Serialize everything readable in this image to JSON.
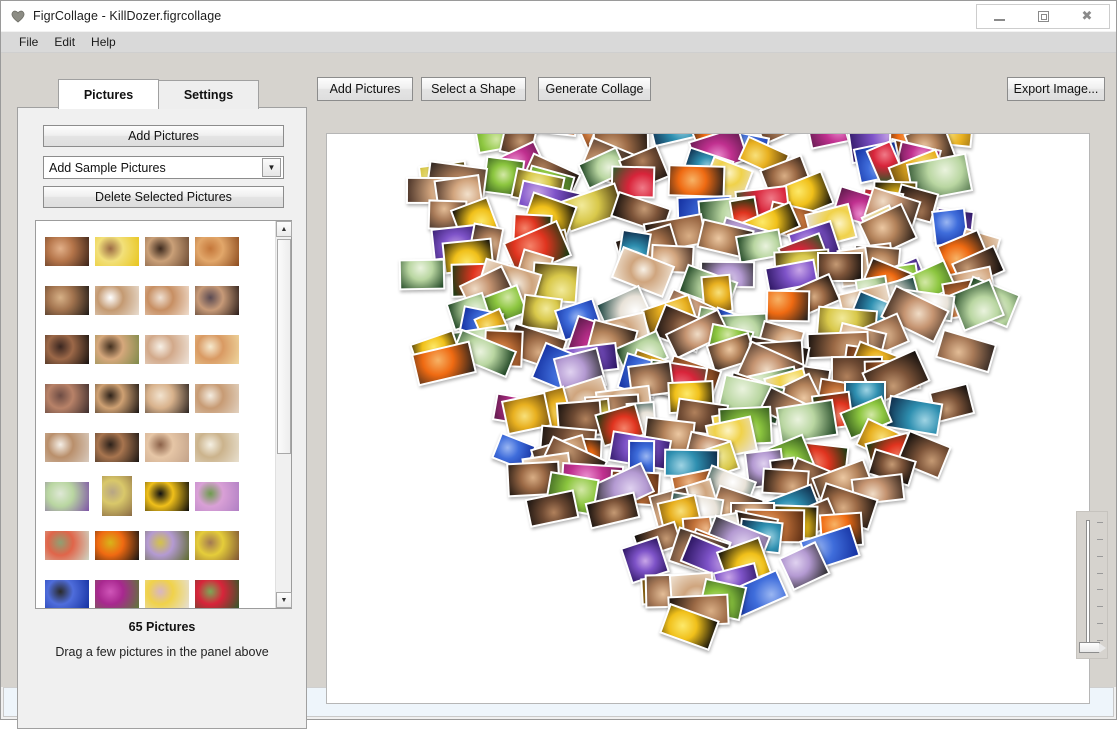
{
  "window": {
    "title": "FigrCollage - KillDozer.figrcollage",
    "app_icon": "heart-icon",
    "minimize_label": "–",
    "maximize_label": "□",
    "close_label": "✕"
  },
  "menubar": {
    "items": [
      {
        "label": "File"
      },
      {
        "label": "Edit"
      },
      {
        "label": "Help"
      }
    ]
  },
  "sidebar": {
    "tabs": [
      {
        "label": "Pictures",
        "active": true
      },
      {
        "label": "Settings",
        "active": false
      }
    ],
    "add_pictures_label": "Add Pictures",
    "sample_combo": {
      "value": "Add Sample Pictures",
      "arrow_icon": "chevron-down-icon"
    },
    "delete_label": "Delete Selected Pictures",
    "scrollbar": {
      "up_icon": "caret-up-icon",
      "down_icon": "caret-down-icon"
    },
    "count_label": "65 Pictures",
    "hint_label": "Drag a few pictures in the panel above",
    "thumbnails": [
      {
        "kind": "portrait",
        "c1": "#3b2318",
        "c2": "#b5754a",
        "c3": "#e2b089"
      },
      {
        "kind": "portrait",
        "c1": "#e8c51d",
        "c2": "#f2e07a",
        "c3": "#9c6b45"
      },
      {
        "kind": "portrait",
        "c1": "#6b4a33",
        "c2": "#caa078",
        "c3": "#3d2a1e"
      },
      {
        "kind": "portrait",
        "c1": "#8b4a1e",
        "c2": "#e2a76a",
        "c3": "#c4773a"
      },
      {
        "kind": "portrait",
        "c1": "#1f1a16",
        "c2": "#a3744f",
        "c3": "#d7b187"
      },
      {
        "kind": "portrait",
        "c1": "#e9ddd0",
        "c2": "#c49a72",
        "c3": "#ffffff"
      },
      {
        "kind": "portrait",
        "c1": "#f0ddcd",
        "c2": "#c78f63",
        "c3": "#efe0d2"
      },
      {
        "kind": "portrait",
        "c1": "#2a1c18",
        "c2": "#c79a78",
        "c3": "#5a4a52"
      },
      {
        "kind": "portrait",
        "c1": "#17110e",
        "c2": "#9c6848",
        "c3": "#3a2620"
      },
      {
        "kind": "portrait",
        "c1": "#7d8a4a",
        "c2": "#d6a87c",
        "c3": "#43301f"
      },
      {
        "kind": "portrait",
        "c1": "#efe4d9",
        "c2": "#d2a98a",
        "c3": "#f7f0e6"
      },
      {
        "kind": "portrait",
        "c1": "#efd79f",
        "c2": "#d99a63",
        "c3": "#f6e9cd"
      },
      {
        "kind": "portrait",
        "c1": "#3c2c2c",
        "c2": "#b88268",
        "c3": "#6d4c44"
      },
      {
        "kind": "portrait",
        "c1": "#1a1512",
        "c2": "#cfa173",
        "c3": "#2e2219"
      },
      {
        "kind": "portrait",
        "c1": "#2b2320",
        "c2": "#d8b28c",
        "c3": "#f2e3cf"
      },
      {
        "kind": "portrait",
        "c1": "#e2d2c0",
        "c2": "#c79b74",
        "c3": "#f4ece0"
      },
      {
        "kind": "portrait",
        "c1": "#d9cbbe",
        "c2": "#b98f6b",
        "c3": "#f5efe7"
      },
      {
        "kind": "portrait",
        "c1": "#1b1613",
        "c2": "#a8754f",
        "c3": "#2c211a"
      },
      {
        "kind": "portrait",
        "c1": "#c2a289",
        "c2": "#e6c6a6",
        "c3": "#8b6148"
      },
      {
        "kind": "portrait",
        "c1": "#e8e0cf",
        "c2": "#cbb38c",
        "c3": "#f5f0e3"
      },
      {
        "kind": "flower",
        "c1": "#7e53a8",
        "c2": "#b9d6a1",
        "c3": "#dfe8d6"
      },
      {
        "kind": "flower-tall",
        "c1": "#8a6b45",
        "c2": "#d9c86a",
        "c3": "#b7a585"
      },
      {
        "kind": "flower",
        "c1": "#0a0a0a",
        "c2": "#f0c01a",
        "c3": "#111111"
      },
      {
        "kind": "flower",
        "c1": "#b07fc4",
        "c2": "#d9a0d6",
        "c3": "#6f9c4f"
      },
      {
        "kind": "flower",
        "c1": "#cfd7c6",
        "c2": "#e0654a",
        "c3": "#8fa073"
      },
      {
        "kind": "flower",
        "c1": "#141414",
        "c2": "#f06a12",
        "c3": "#d8b41a"
      },
      {
        "kind": "flower",
        "c1": "#5d6b2c",
        "c2": "#b49ad2",
        "c3": "#d4c24a"
      },
      {
        "kind": "flower",
        "c1": "#7e5435",
        "c2": "#e5cd3a",
        "c3": "#a37a52"
      },
      {
        "kind": "flower",
        "c1": "#1430a0",
        "c2": "#4f6ddb",
        "c3": "#2a2a2a"
      },
      {
        "kind": "flower",
        "c1": "#5b7a35",
        "c2": "#a8288f",
        "c3": "#cf55b8"
      },
      {
        "kind": "flower",
        "c1": "#e6e0da",
        "c2": "#f0d24a",
        "c3": "#d8b6c4"
      },
      {
        "kind": "flower",
        "c1": "#2d5a2a",
        "c2": "#d8243a",
        "c3": "#7aa856"
      }
    ]
  },
  "toolbar": {
    "add_pictures_label": "Add Pictures",
    "select_shape_label": "Select a Shape",
    "generate_label": "Generate Collage",
    "export_label": "Export Image..."
  },
  "canvas": {
    "shape": "heart",
    "background": "#ffffff",
    "zoom_slider": {
      "name": "zoom-slider",
      "value_position": "bottom",
      "tick_count": 8
    }
  },
  "statusbar": {
    "text": ""
  },
  "collage": {
    "photo_count": 260,
    "palette": [
      [
        "#2b1d14",
        "#a5apx",
        "#d9b089"
      ],
      [
        "#7e53a8",
        "#b9d6a1",
        "#dfe8d6"
      ]
    ]
  }
}
